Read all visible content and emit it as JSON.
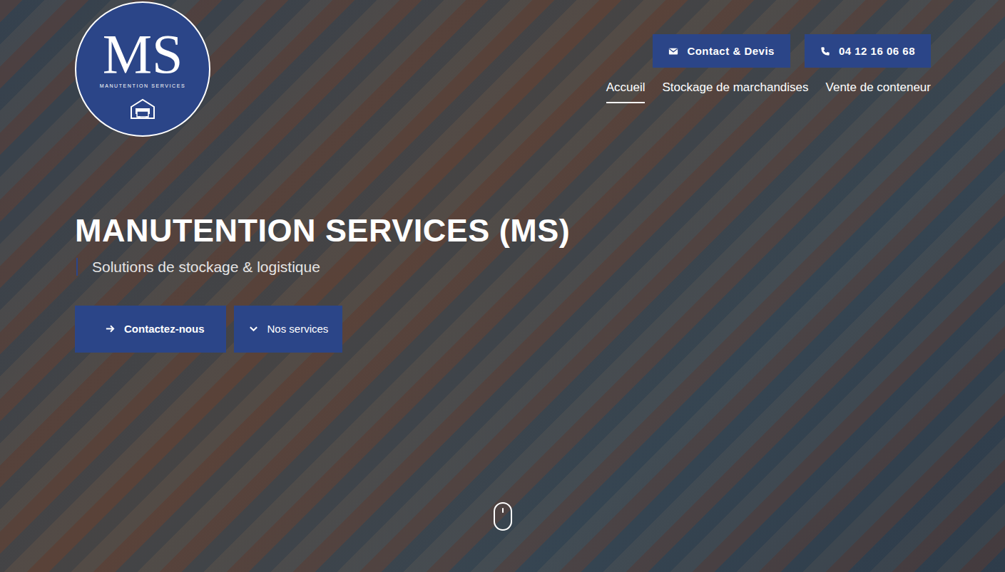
{
  "logo": {
    "initials": "MS",
    "name": "MANUTENTION SERVICES"
  },
  "top_buttons": [
    {
      "label": "Contact & Devis",
      "kind": "email"
    },
    {
      "label": "04 12 16 06 68",
      "kind": "phone"
    }
  ],
  "nav": [
    {
      "label": "Accueil",
      "selected": true
    },
    {
      "label": "Stockage de marchandises",
      "selected": false
    },
    {
      "label": "Vente de conteneur",
      "selected": false
    }
  ],
  "hero": {
    "title": "MANUTENTION SERVICES (MS)",
    "subtitle": "Solutions de stockage & logistique",
    "buttons": [
      {
        "label": "Contactez-nous",
        "kind": "arrow"
      },
      {
        "label": "Nos services",
        "kind": "chevron"
      }
    ]
  }
}
